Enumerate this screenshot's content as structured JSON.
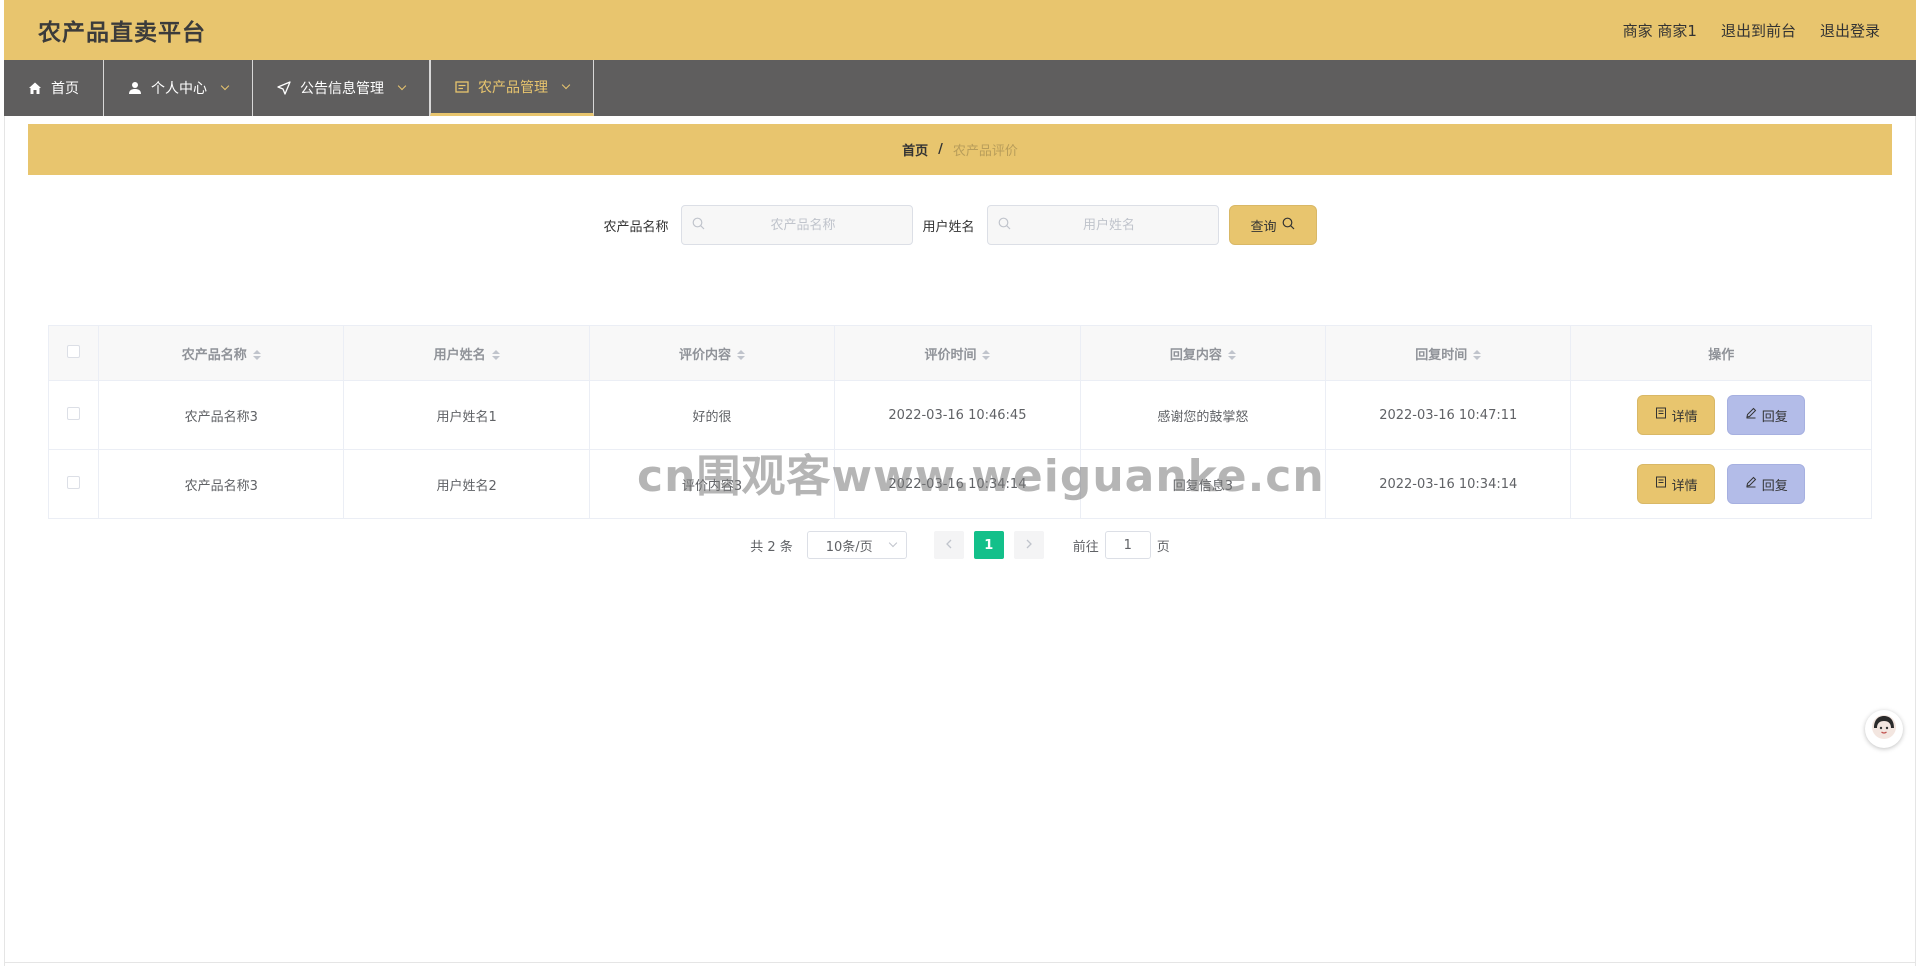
{
  "header": {
    "title": "农产品直卖平台",
    "user": "商家 商家1",
    "back_front": "退出到前台",
    "logout": "退出登录",
    "bg_color": "#e8c56e"
  },
  "nav": {
    "items": [
      {
        "label": "首页",
        "icon": "home-icon"
      },
      {
        "label": "个人中心",
        "icon": "user-icon"
      },
      {
        "label": "公告信息管理",
        "icon": "send-icon"
      },
      {
        "label": "农产品管理",
        "icon": "document-icon",
        "active": true
      }
    ]
  },
  "breadcrumb": {
    "home": "首页",
    "separator": "/",
    "current": "农产品评价"
  },
  "search": {
    "product_label": "农产品名称",
    "product_placeholder": "农产品名称",
    "user_label": "用户姓名",
    "user_placeholder": "用户姓名",
    "button": "查询"
  },
  "table": {
    "headers": [
      "农产品名称",
      "用户姓名",
      "评价内容",
      "评价时间",
      "回复内容",
      "回复时间",
      "操作"
    ],
    "rows": [
      [
        "农产品名称3",
        "用户姓名1",
        "好的很",
        "2022-03-16 10:46:45",
        "感谢您的鼓掌怒",
        "2022-03-16 10:47:11"
      ],
      [
        "农产品名称3",
        "用户姓名2",
        "评价内容3",
        "2022-03-16 10:34:14",
        "回复信息3",
        "2022-03-16 10:34:14"
      ]
    ],
    "detail_label": "详情",
    "reply_label": "回复"
  },
  "pagination": {
    "total": "共 2 条",
    "page_size": "10条/页",
    "current_page": "1",
    "goto_label": "前往",
    "goto_value": "1",
    "page_unit": "页",
    "active_color": "#13c08a"
  },
  "watermark": "cn围观客www.weiguanke.cn"
}
